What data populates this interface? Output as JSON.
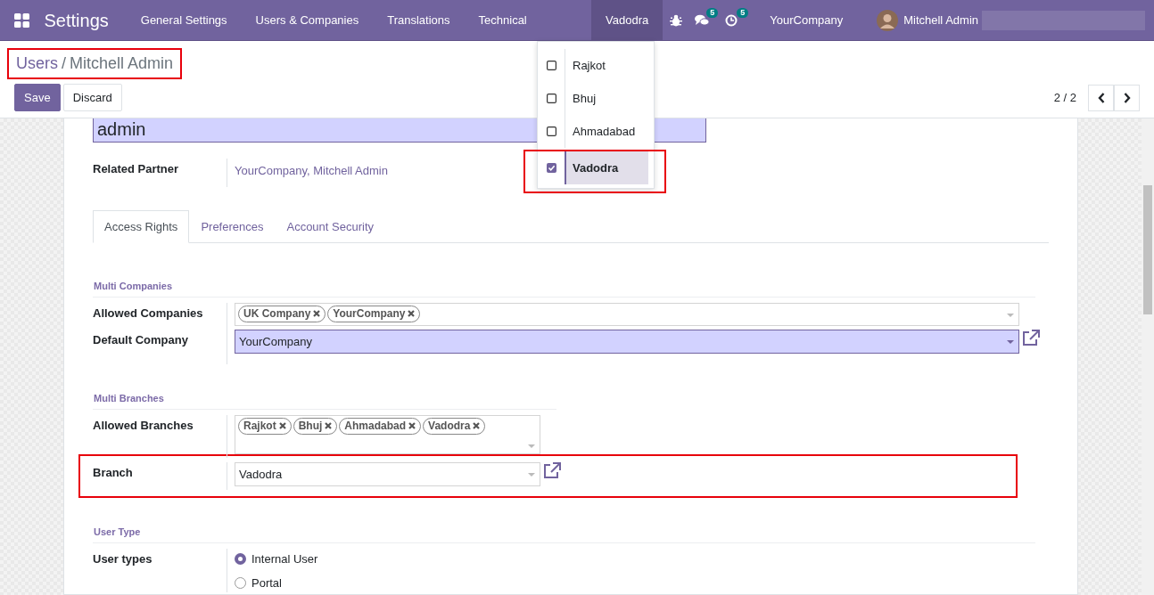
{
  "navbar": {
    "app_title": "Settings",
    "menu": [
      "General Settings",
      "Users & Companies",
      "Translations",
      "Technical"
    ],
    "branch_switcher": "Vadodra",
    "messages_badge": "5",
    "activities_badge": "5",
    "company": "YourCompany",
    "user": "Mitchell Admin"
  },
  "branch_dropdown": [
    {
      "label": "Rajkot",
      "checked": false,
      "annotated": false
    },
    {
      "label": "Bhuj",
      "checked": false,
      "annotated": false
    },
    {
      "label": "Ahmadabad",
      "checked": false,
      "annotated": false
    },
    {
      "label": "Vadodra",
      "checked": true,
      "annotated": true
    }
  ],
  "breadcrumb": {
    "items": [
      "Users",
      "Mitchell Admin"
    ],
    "separator": "/",
    "annotated": true
  },
  "buttons": [
    "Save",
    "Discard"
  ],
  "pager": "2 / 2",
  "form": {
    "login": "admin",
    "related_partner_label": "Related Partner",
    "related_partner": "YourCompany, Mitchell Admin",
    "tabs": [
      {
        "label": "Access Rights",
        "selected": true
      },
      {
        "label": "Preferences",
        "selected": false
      },
      {
        "label": "Account Security",
        "selected": false
      }
    ],
    "sections": [
      {
        "title": "Multi Companies",
        "narrow": false,
        "fields": [
          {
            "label": "Allowed Companies",
            "kind": "tags",
            "tags": [
              "UK Company",
              "YourCompany"
            ],
            "required": false,
            "external_link": false,
            "annotated": false
          },
          {
            "label": "Default Company",
            "kind": "select",
            "value": "YourCompany",
            "required": true,
            "external_link": true,
            "annotated": false
          }
        ]
      },
      {
        "title": "Multi Branches",
        "narrow": true,
        "fields": [
          {
            "label": "Allowed Branches",
            "kind": "tags",
            "tags": [
              "Rajkot",
              "Bhuj",
              "Ahmadabad",
              "Vadodra"
            ],
            "required": false,
            "external_link": false,
            "annotated": false
          },
          {
            "label": "Branch",
            "kind": "select",
            "value": "Vadodra",
            "required": false,
            "external_link": true,
            "annotated": true
          }
        ]
      },
      {
        "title": "User Type",
        "narrow": false,
        "fields": [
          {
            "label": "User types",
            "kind": "radio",
            "options": [
              {
                "label": "Internal User",
                "selected": true
              },
              {
                "label": "Portal",
                "selected": false
              }
            ],
            "annotated": false
          }
        ]
      }
    ]
  }
}
